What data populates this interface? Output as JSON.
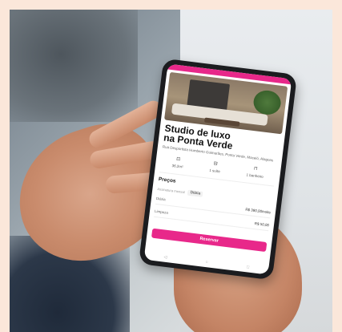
{
  "listing": {
    "title_line1": "Studio de luxo",
    "title_line2": "na Ponta Verde",
    "address": "Rua Desportista Humberto Guimarães, Ponta Verde, Maceió, Alagoas",
    "features": [
      {
        "icon": "area-icon",
        "glyph": "⊡",
        "label": "36,2m²"
      },
      {
        "icon": "bed-icon",
        "glyph": "⊟",
        "label": "1 suíte"
      },
      {
        "icon": "bath-icon",
        "glyph": "⊓",
        "label": "1 banheiro"
      }
    ]
  },
  "prices": {
    "section_title": "Preços",
    "tab_inactive": "Assinatura mensal",
    "tab_active": "Diária",
    "rows": [
      {
        "label": "Diária",
        "value": "R$ 390,00/noite"
      },
      {
        "label": "Limpeza",
        "value": "R$ 50,00"
      }
    ]
  },
  "cta": {
    "label": "Reservar"
  },
  "nav": {
    "back": "◁",
    "home": "○",
    "recent": "□"
  },
  "colors": {
    "accent": "#e8288a"
  }
}
